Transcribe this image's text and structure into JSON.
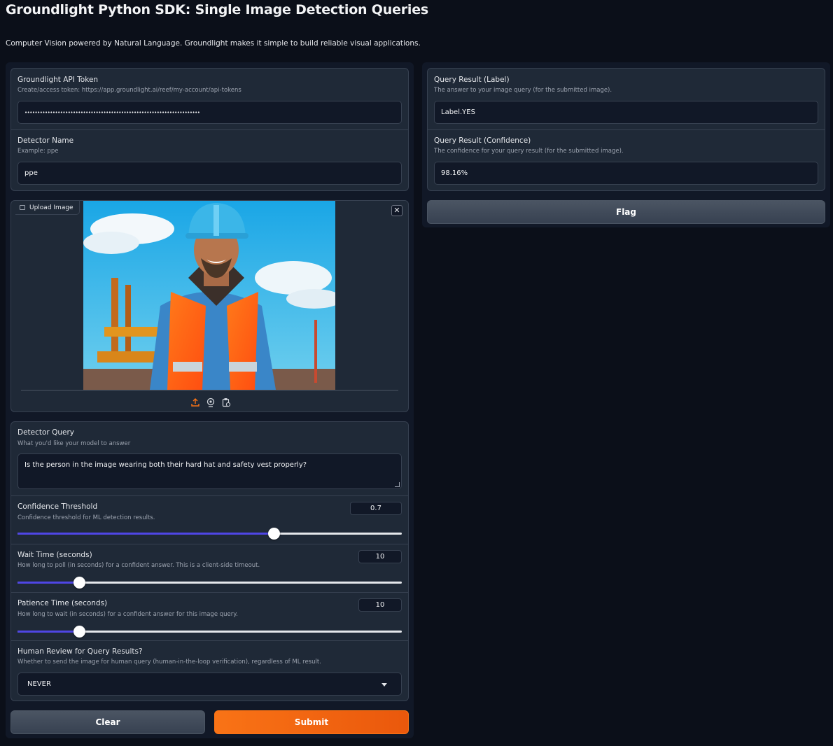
{
  "header": {
    "title": "Groundlight Python SDK: Single Image Detection Queries",
    "subtitle": "Computer Vision powered by Natural Language. Groundlight makes it simple to build reliable visual applications."
  },
  "api_token": {
    "label": "Groundlight API Token",
    "info": "Create/access token: https://app.groundlight.ai/reef/my-account/api-tokens",
    "value": "•••••••••••••••••••••••••••••••••••••••••••••••••••••••••••••••••••••"
  },
  "detector_name": {
    "label": "Detector Name",
    "info": "Example: ppe",
    "value": "ppe"
  },
  "upload": {
    "label": "Upload Image",
    "close_glyph": "✕",
    "image_alt": "Construction worker wearing hard hat and safety vest"
  },
  "detector_query": {
    "label": "Detector Query",
    "info": "What you'd like your model to answer",
    "value": "Is the person in the image wearing both their hard hat and safety vest properly?"
  },
  "confidence": {
    "label": "Confidence Threshold",
    "info": "Confidence threshold for ML detection results.",
    "value": "0.7",
    "fraction": 0.667
  },
  "wait_time": {
    "label": "Wait Time (seconds)",
    "info": "How long to poll (in seconds) for a confident answer. This is a client-side timeout.",
    "value": "10",
    "fraction": 0.161
  },
  "patience_time": {
    "label": "Patience Time (seconds)",
    "info": "How long to wait (in seconds) for a confident answer for this image query.",
    "value": "10",
    "fraction": 0.161
  },
  "human_review": {
    "label": "Human Review for Query Results?",
    "info": "Whether to send the image for human query (human-in-the-loop verification), regardless of ML result.",
    "value": "NEVER"
  },
  "buttons": {
    "clear": "Clear",
    "submit": "Submit",
    "flag": "Flag"
  },
  "result_label": {
    "label": "Query Result (Label)",
    "info": "The answer to your image query (for the submitted image).",
    "value": "Label.YES"
  },
  "result_confidence": {
    "label": "Query Result (Confidence)",
    "info": "The confidence for your query result (for the submitted image).",
    "value": "98.16%"
  },
  "colors": {
    "accent": "#4f46e5",
    "primary": "#f97316",
    "background": "#0b0f19",
    "panel": "#1f2937"
  }
}
